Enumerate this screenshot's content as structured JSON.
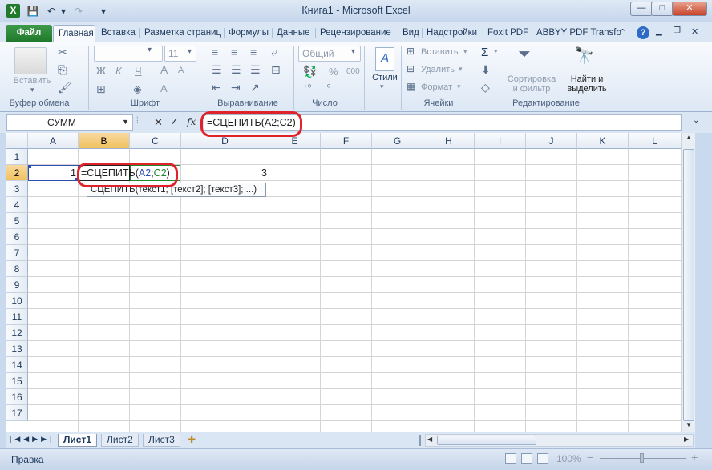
{
  "window": {
    "title": "Книга1 - Microsoft Excel",
    "minimize": "—",
    "maximize": "□",
    "close": "✕"
  },
  "quick_access": {
    "save": "💾",
    "undo": "↶",
    "redo": "↷",
    "customize": "▾"
  },
  "tabs": [
    {
      "label": "Файл"
    },
    {
      "label": "Главная"
    },
    {
      "label": "Вставка"
    },
    {
      "label": "Разметка страниц"
    },
    {
      "label": "Формулы"
    },
    {
      "label": "Данные"
    },
    {
      "label": "Рецензирование"
    },
    {
      "label": "Вид"
    },
    {
      "label": "Надстройки"
    },
    {
      "label": "Foxit PDF"
    },
    {
      "label": "ABBYY PDF Transfo"
    }
  ],
  "ribbon": {
    "clipboard": {
      "paste_label": "Вставить",
      "group": "Буфер обмена"
    },
    "font": {
      "font_size": "11",
      "bold": "Ж",
      "italic": "К",
      "underline": "Ч",
      "grow": "A",
      "shrink": "A",
      "group": "Шрифт"
    },
    "alignment": {
      "group": "Выравнивание"
    },
    "number": {
      "format": "Общий",
      "group": "Число",
      "percent": "%",
      "thousands": "000"
    },
    "styles": {
      "label": "Стили"
    },
    "cells": {
      "insert": "Вставить",
      "delete": "Удалить",
      "format": "Формат",
      "group": "Ячейки"
    },
    "editing": {
      "sum": "Σ",
      "sort_filter": "Сортировка\nи фильтр",
      "find_select": "Найти и\nвыделить",
      "group": "Редактирование"
    }
  },
  "formula_bar": {
    "name_box": "СУММ",
    "cancel": "✕",
    "enter": "✓",
    "fx": "fx",
    "formula": "=СЦЕПИТЬ(A2;C2)"
  },
  "grid": {
    "columns": [
      "A",
      "B",
      "C",
      "D",
      "E",
      "F",
      "G",
      "H",
      "I",
      "J",
      "K",
      "L"
    ],
    "rows": [
      "1",
      "2",
      "3",
      "4",
      "5",
      "6",
      "7",
      "8",
      "9",
      "10",
      "11",
      "12",
      "13",
      "14",
      "15",
      "16",
      "17"
    ],
    "cells": {
      "A2": "1",
      "D2": "3"
    },
    "edit_cell": {
      "prefix": "=СЦЕПИТЬ(",
      "ref1": "A2",
      "sep": ";",
      "ref2": "C2",
      "suffix": ")"
    },
    "tooltip": "СЦЕПИТЬ(текст1; [текст2]; [текст3]; ...)"
  },
  "sheets": [
    {
      "label": "Лист1"
    },
    {
      "label": "Лист2"
    },
    {
      "label": "Лист3"
    }
  ],
  "status": {
    "mode": "Правка",
    "zoom": "100%",
    "zoom_minus": "−",
    "zoom_plus": "+"
  },
  "colors": {
    "ref1": "#2f4fb3",
    "ref2": "#1a8a2a",
    "annotation": "#e0232a",
    "accent": "#1f7a2c"
  }
}
